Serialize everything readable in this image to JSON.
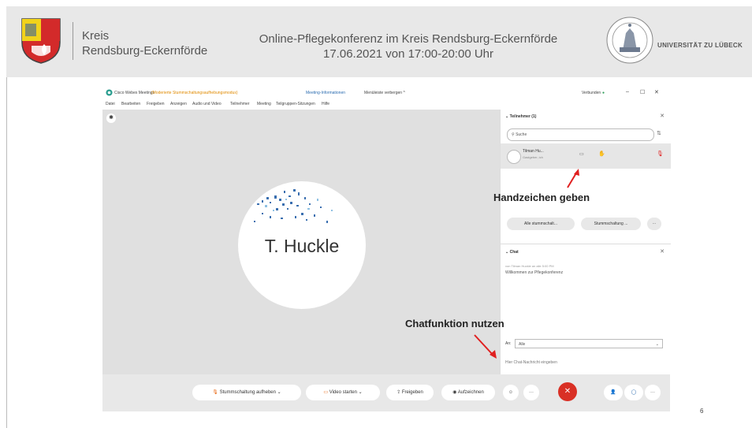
{
  "slide_header": {
    "district_line1": "Kreis",
    "district_line2": "Rendsburg-Eckernförde",
    "conference_title": "Online-Pflegekonferenz im Kreis Rendsburg-Eckernförde",
    "conference_date": "17.06.2021 von 17:00-20:00 Uhr",
    "university": "UNIVERSITÄT ZU LÜBECK"
  },
  "webex": {
    "title_bar": {
      "app_title": "Cisco Webex Meetings",
      "mode": "(Moderierte Stummschaltungsaufhebungsmodus)",
      "meeting_info": "Meeting-Informationen",
      "hide_menu": "Menüleiste verbergen ^",
      "connection": "Verbunden",
      "minimize": "–",
      "maximize": "☐",
      "close": "✕"
    },
    "menu": [
      "Datei",
      "Bearbeiten",
      "Freigeben",
      "Anzeigen",
      "Audio und Video",
      "Teilnehmer",
      "Meeting",
      "Teilgruppen-Sitzungen",
      "Hilfe"
    ],
    "stage": {
      "participant_name": "T. Huckle"
    },
    "controls": {
      "unmute": "Stummschaltung aufheben",
      "start_video": "Video starten",
      "share": "Freigeben",
      "record": "Aufzeichnen",
      "end": "✕"
    },
    "participants_panel": {
      "title": "Teilnehmer (1)",
      "search_placeholder": "Suche",
      "participant_name": "Tilman Hu...",
      "participant_role": "Gastgeber, ich",
      "mute_all": "Alle stummschalt...",
      "unmute_all": "Stummschaltung ...",
      "more": "···"
    },
    "chat_panel": {
      "title": "Chat",
      "message_meta": "von Tilman Huckle an alle   5:00 PM",
      "message_text": "Willkommen zur Pflegekonferenz",
      "to_label": "An:",
      "to_value": "Alle",
      "input_placeholder": "Hier Chat-Nachricht eingeben"
    }
  },
  "annotations": {
    "raise_hand": "Handzeichen geben",
    "chat_function": "Chatfunktion nutzen"
  },
  "page_number": "6",
  "colors": {
    "annotation_arrow": "#e02020",
    "end_button": "#d93025",
    "unmute_icon": "#e65c00"
  }
}
